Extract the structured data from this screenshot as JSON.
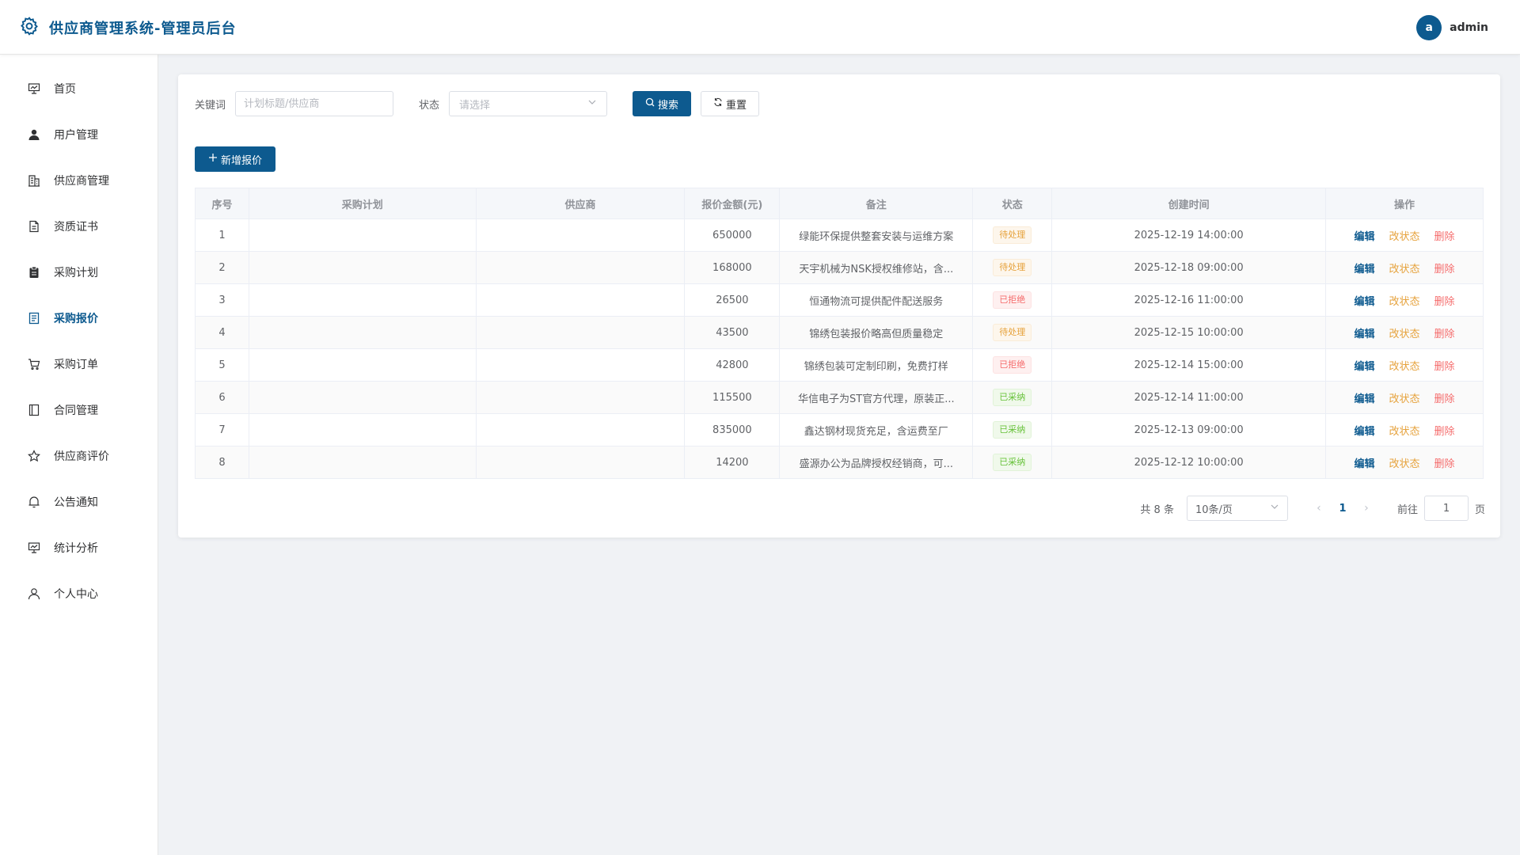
{
  "header": {
    "title": "供应商管理系统-管理员后台",
    "avatar_letter": "a",
    "username": "admin"
  },
  "sidebar": {
    "items": [
      {
        "label": "首页",
        "icon": "dashboard-icon"
      },
      {
        "label": "用户管理",
        "icon": "user-icon"
      },
      {
        "label": "供应商管理",
        "icon": "building-icon"
      },
      {
        "label": "资质证书",
        "icon": "document-icon"
      },
      {
        "label": "采购计划",
        "icon": "clipboard-icon"
      },
      {
        "label": "采购报价",
        "icon": "tickets-icon",
        "active": true
      },
      {
        "label": "采购订单",
        "icon": "cart-icon"
      },
      {
        "label": "合同管理",
        "icon": "notebook-icon"
      },
      {
        "label": "供应商评价",
        "icon": "star-icon"
      },
      {
        "label": "公告通知",
        "icon": "bell-icon"
      },
      {
        "label": "统计分析",
        "icon": "chart-icon"
      },
      {
        "label": "个人中心",
        "icon": "person-icon"
      }
    ]
  },
  "filter": {
    "keyword_label": "关键词",
    "keyword_placeholder": "计划标题/供应商",
    "keyword_value": "",
    "status_label": "状态",
    "status_placeholder": "请选择",
    "search_label": "搜索",
    "reset_label": "重置"
  },
  "toolbar": {
    "add_label": "新增报价"
  },
  "table": {
    "columns": [
      "序号",
      "采购计划",
      "供应商",
      "报价金额(元)",
      "备注",
      "状态",
      "创建时间",
      "操作"
    ],
    "actions": {
      "edit": "编辑",
      "status": "改状态",
      "delete": "删除"
    },
    "rows": [
      {
        "idx": "1",
        "plan": "",
        "supplier": "",
        "amount": "650000",
        "note": "绿能环保提供整套安装与运维方案",
        "status": "待处理",
        "status_type": "pending",
        "time": "2025-12-19 14:00:00"
      },
      {
        "idx": "2",
        "plan": "",
        "supplier": "",
        "amount": "168000",
        "note": "天宇机械为NSK授权维修站，含...",
        "status": "待处理",
        "status_type": "pending",
        "time": "2025-12-18 09:00:00"
      },
      {
        "idx": "3",
        "plan": "",
        "supplier": "",
        "amount": "26500",
        "note": "恒通物流可提供配件配送服务",
        "status": "已拒绝",
        "status_type": "rejected",
        "time": "2025-12-16 11:00:00"
      },
      {
        "idx": "4",
        "plan": "",
        "supplier": "",
        "amount": "43500",
        "note": "锦绣包装报价略高但质量稳定",
        "status": "待处理",
        "status_type": "pending",
        "time": "2025-12-15 10:00:00"
      },
      {
        "idx": "5",
        "plan": "",
        "supplier": "",
        "amount": "42800",
        "note": "锦绣包装可定制印刷，免费打样",
        "status": "已拒绝",
        "status_type": "rejected",
        "time": "2025-12-14 15:00:00"
      },
      {
        "idx": "6",
        "plan": "",
        "supplier": "",
        "amount": "115500",
        "note": "华信电子为ST官方代理，原装正...",
        "status": "已采纳",
        "status_type": "accepted",
        "time": "2025-12-14 11:00:00"
      },
      {
        "idx": "7",
        "plan": "",
        "supplier": "",
        "amount": "835000",
        "note": "鑫达钢材现货充足，含运费至厂",
        "status": "已采纳",
        "status_type": "accepted",
        "time": "2025-12-13 09:00:00"
      },
      {
        "idx": "8",
        "plan": "",
        "supplier": "",
        "amount": "14200",
        "note": "盛源办公为品牌授权经销商，可...",
        "status": "已采纳",
        "status_type": "accepted",
        "time": "2025-12-12 10:00:00"
      }
    ]
  },
  "pagination": {
    "total_text": "共 8 条",
    "page_size": "10条/页",
    "current_page": "1",
    "goto_label": "前往",
    "goto_value": "1",
    "page_suffix": "页"
  },
  "colors": {
    "brand": "#0d5a8f",
    "pending": "#e6a23c",
    "rejected": "#f56c6c",
    "accepted": "#67c23a"
  }
}
